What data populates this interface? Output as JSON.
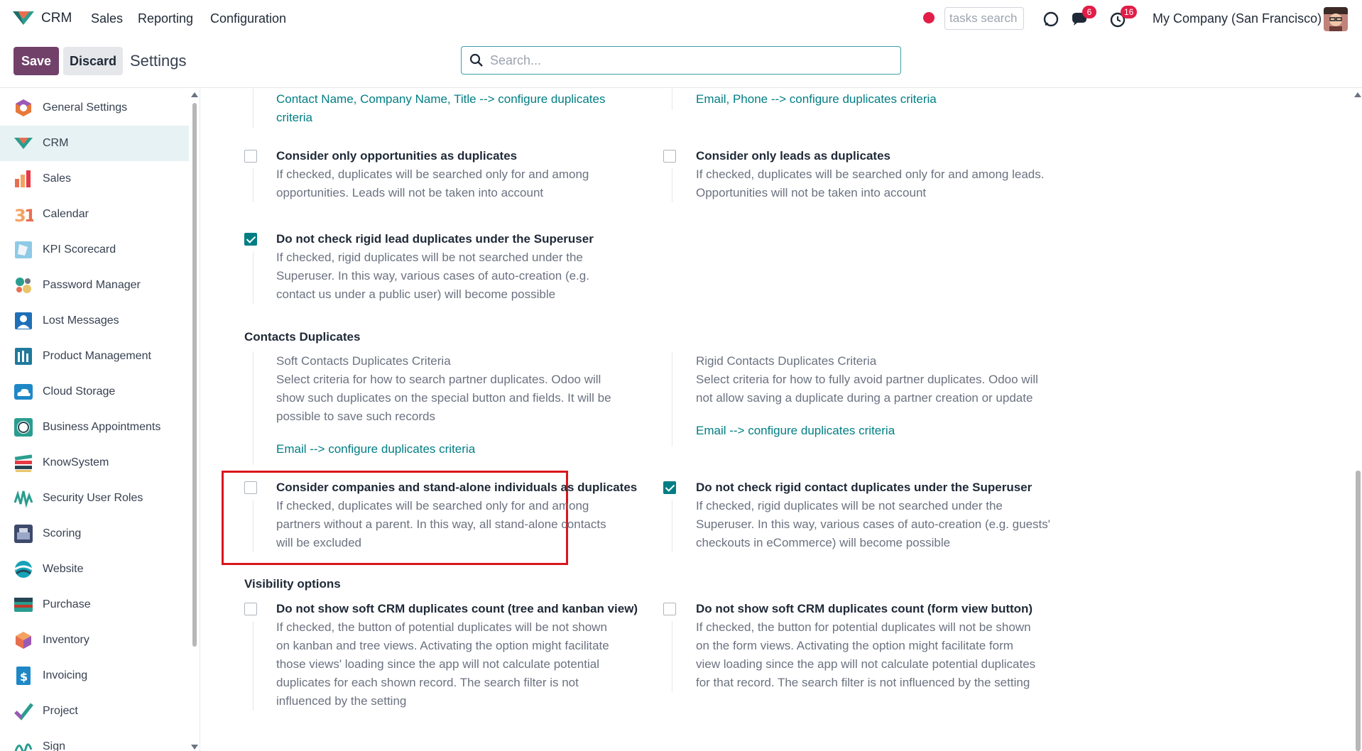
{
  "app": {
    "name": "CRM",
    "menu": [
      "Sales",
      "Reporting",
      "Configuration"
    ],
    "tasks_search_placeholder": "tasks search",
    "chat_badge": "6",
    "activity_badge": "16",
    "company": "My Company (San Francisco)"
  },
  "controls": {
    "save_label": "Save",
    "discard_label": "Discard",
    "page_title": "Settings",
    "search_placeholder": "Search..."
  },
  "sidebar": {
    "active": "CRM",
    "items": [
      {
        "label": "General Settings",
        "icon": "general-settings-icon"
      },
      {
        "label": "CRM",
        "icon": "crm-icon"
      },
      {
        "label": "Sales",
        "icon": "sales-icon"
      },
      {
        "label": "Calendar",
        "icon": "calendar-icon"
      },
      {
        "label": "KPI Scorecard",
        "icon": "kpi-scorecard-icon"
      },
      {
        "label": "Password Manager",
        "icon": "password-manager-icon"
      },
      {
        "label": "Lost Messages",
        "icon": "lost-messages-icon"
      },
      {
        "label": "Product Management",
        "icon": "product-management-icon"
      },
      {
        "label": "Cloud Storage",
        "icon": "cloud-storage-icon"
      },
      {
        "label": "Business Appointments",
        "icon": "business-appointments-icon"
      },
      {
        "label": "KnowSystem",
        "icon": "knowsystem-icon"
      },
      {
        "label": "Security User Roles",
        "icon": "security-user-roles-icon"
      },
      {
        "label": "Scoring",
        "icon": "scoring-icon"
      },
      {
        "label": "Website",
        "icon": "website-icon"
      },
      {
        "label": "Purchase",
        "icon": "purchase-icon"
      },
      {
        "label": "Inventory",
        "icon": "inventory-icon"
      },
      {
        "label": "Invoicing",
        "icon": "invoicing-icon"
      },
      {
        "label": "Project",
        "icon": "project-icon"
      },
      {
        "label": "Sign",
        "icon": "sign-icon"
      }
    ]
  },
  "content": {
    "top_left_link_1": "Contact Name, Company Name, Title --> configure duplicates",
    "top_left_link_2": "criteria",
    "top_right_link": "Email, Phone --> configure duplicates criteria",
    "opp_only": {
      "title": "Consider only opportunities as duplicates",
      "desc": [
        "If checked, duplicates will be searched only for and among",
        "opportunities. Leads will not be taken into account"
      ],
      "checked": false
    },
    "leads_only": {
      "title": "Consider only leads as duplicates",
      "desc": [
        "If checked, duplicates will be searched only for and among leads.",
        "Opportunities will not be taken into account"
      ],
      "checked": false
    },
    "rigid_lead_superuser": {
      "title": "Do not check rigid lead duplicates under the Superuser",
      "desc": [
        "If checked, rigid duplicates will be not searched under the",
        "Superuser. In this way, various cases of auto-creation (e.g.",
        "contact us under a public user) will become possible"
      ],
      "checked": true
    },
    "contacts_section": "Contacts Duplicates",
    "soft_contacts": {
      "label": "Soft Contacts Duplicates Criteria",
      "desc": [
        "Select criteria for how to search partner duplicates. Odoo will",
        "show such duplicates on the special button and fields. It will be",
        "possible to save such records"
      ],
      "link": "Email --> configure duplicates criteria"
    },
    "rigid_contacts": {
      "label": "Rigid Contacts Duplicates Criteria",
      "desc": [
        "Select criteria for how to fully avoid partner duplicates. Odoo will",
        "not allow saving a duplicate during a partner creation or update"
      ],
      "link": "Email --> configure duplicates criteria"
    },
    "companies_individuals": {
      "title": "Consider companies and stand-alone individuals as duplicates",
      "desc": [
        "If checked, duplicates will be searched only for and among",
        "partners without a parent. In this way, all stand-alone contacts",
        "will be excluded"
      ],
      "checked": false
    },
    "rigid_contact_superuser": {
      "title": "Do not check rigid contact duplicates under the Superuser",
      "desc": [
        "If checked, rigid duplicates will be not searched under the",
        "Superuser. In this way, various cases of auto-creation (e.g. guests'",
        "checkouts in eCommerce) will become possible"
      ],
      "checked": true
    },
    "visibility_section": "Visibility options",
    "soft_count_tree": {
      "title": "Do not show soft CRM duplicates count (tree and kanban view)",
      "desc": [
        "If checked, the button of potential duplicates will be not shown",
        "on kanban and tree views. Activating the option might facilitate",
        "those views' loading since the app will not calculate potential",
        "duplicates for each shown record. The search filter is not",
        "influenced by the setting"
      ],
      "checked": false
    },
    "soft_count_form": {
      "title": "Do not show soft CRM duplicates count (form view button)",
      "desc": [
        "If checked, the button for potential duplicates will not be shown",
        "on the form views. Activating the option might facilitate form",
        "view loading since the app will not calculate potential duplicates",
        "for that record. The search filter is not influenced by the setting"
      ],
      "checked": false
    }
  },
  "colors": {
    "brand": "#71416a",
    "accent": "#017e84",
    "highlight": "#d9161d",
    "badge": "#e11d48"
  }
}
